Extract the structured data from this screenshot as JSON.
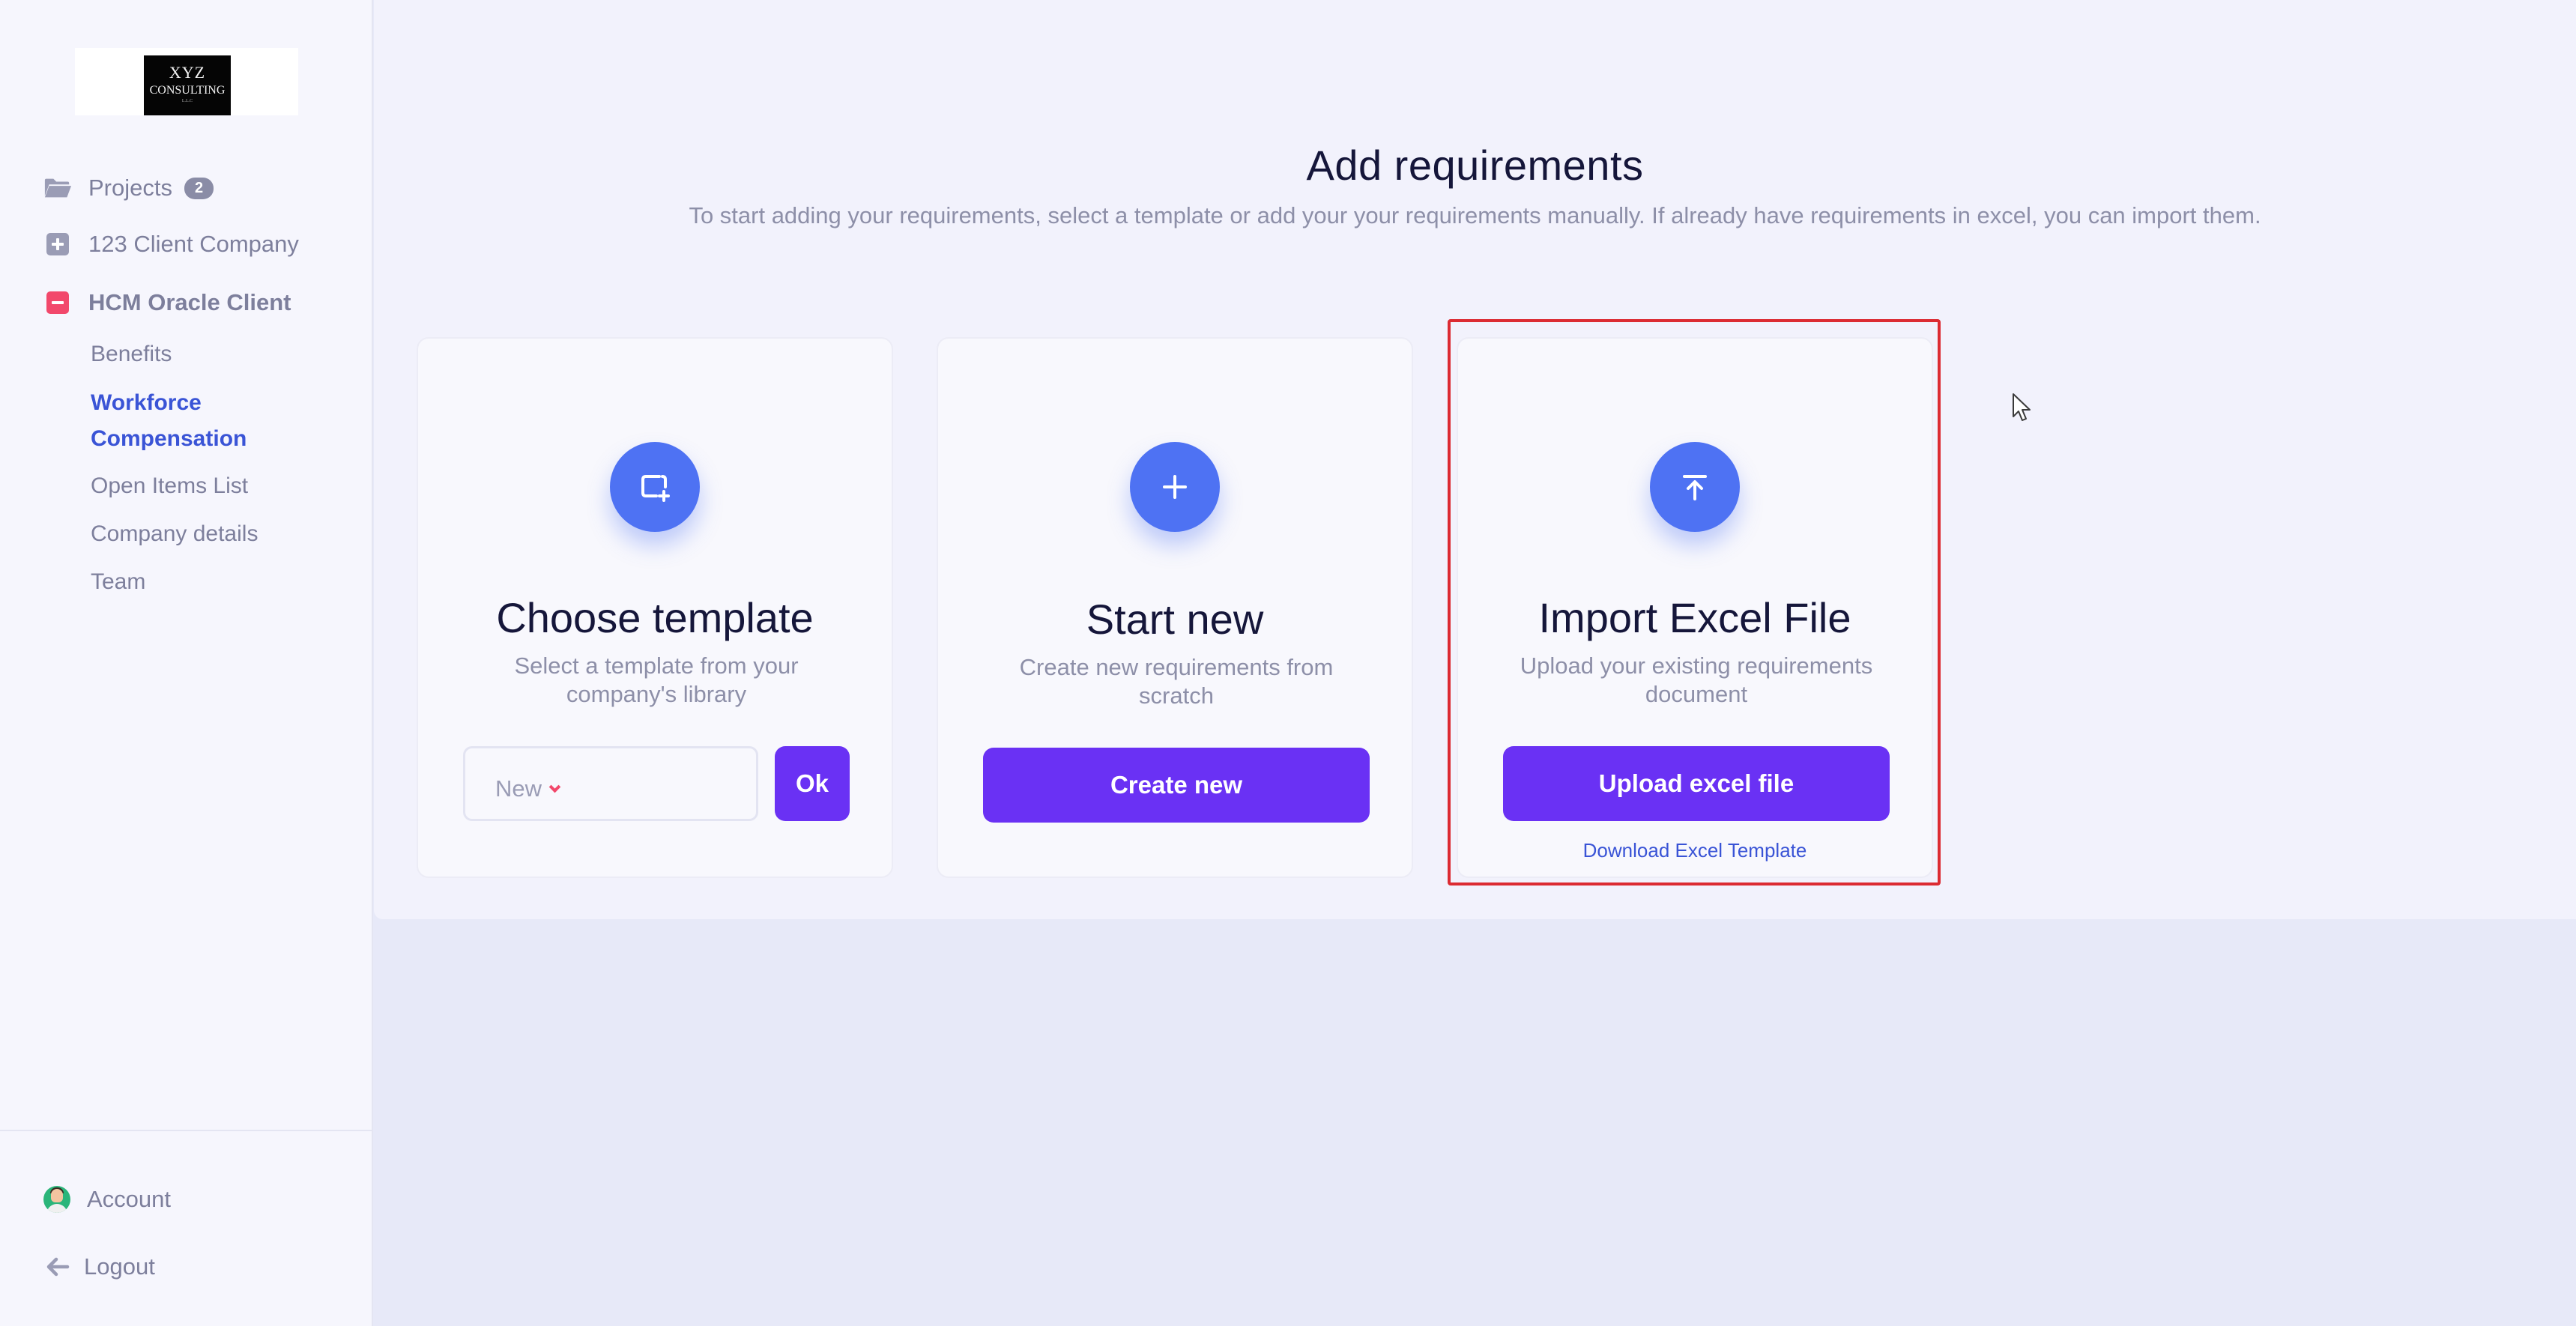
{
  "logo": {
    "line1": "XYZ",
    "line2": "CONSULTING",
    "line3": "L.L.C"
  },
  "sidebar": {
    "projects": {
      "label": "Projects",
      "badge": "2",
      "icon": "folder-icon"
    },
    "clients": [
      {
        "label": "123 Client Company",
        "icon": "plus-square-icon",
        "expanded": false
      },
      {
        "label": "HCM Oracle Client",
        "icon": "minus-square-icon",
        "expanded": true
      }
    ],
    "sub_items": [
      {
        "label": "Benefits",
        "active": false
      },
      {
        "label": "Workforce Compensation",
        "line1": "Workforce",
        "line2": "Compensation",
        "active": true
      },
      {
        "label": "Open Items List",
        "active": false
      },
      {
        "label": "Company details",
        "active": false
      },
      {
        "label": "Team",
        "active": false
      }
    ],
    "account_label": "Account",
    "logout_label": "Logout"
  },
  "main": {
    "title": "Add requirements",
    "subtitle": "To start adding your requirements, select a template or add your your requirements manually. If already have requirements in excel, you can import them.",
    "cards": {
      "template": {
        "icon": "template-add-icon",
        "title": "Choose template",
        "desc": "Select a template from your company's library",
        "select_value": "New",
        "ok_label": "Ok"
      },
      "start_new": {
        "icon": "plus-icon",
        "title": "Start new",
        "desc": "Create new requirements from scratch",
        "button_label": "Create new"
      },
      "import": {
        "icon": "upload-icon",
        "title": "Import Excel File",
        "desc": "Upload your existing requirements document",
        "button_label": "Upload excel file",
        "link_label": "Download Excel Template"
      }
    }
  },
  "colors": {
    "primary_button": "#6a31f4",
    "icon_circle": "#4e72f3",
    "active_link": "#3a54d6",
    "accent_red": "#f2486b",
    "highlight_border": "#dc2b32"
  }
}
